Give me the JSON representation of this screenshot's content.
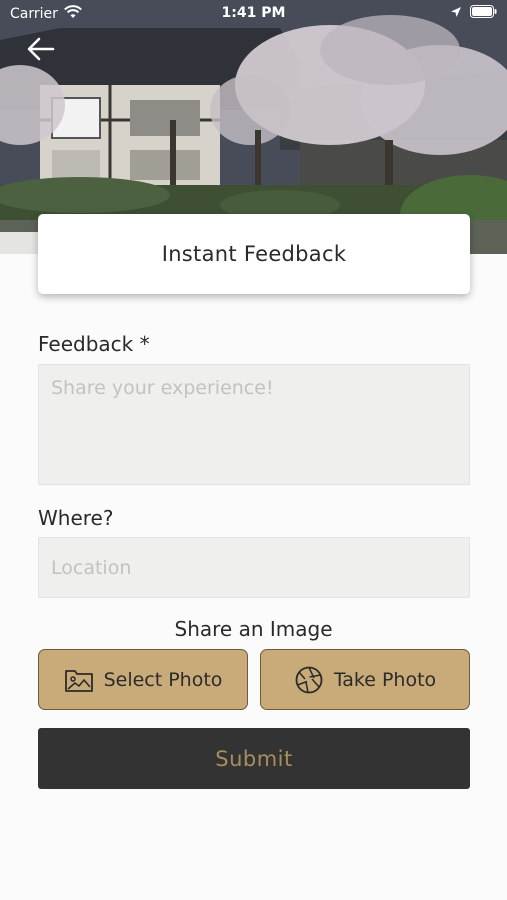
{
  "status_bar": {
    "carrier": "Carrier",
    "time": "1:41 PM"
  },
  "header": {
    "title": "Instant Feedback"
  },
  "form": {
    "feedback_label": "Feedback *",
    "feedback_placeholder": "Share your experience!",
    "feedback_value": "",
    "where_label": "Where?",
    "where_placeholder": "Location",
    "where_value": ""
  },
  "image_share": {
    "title": "Share an Image",
    "select_photo_label": "Select Photo",
    "take_photo_label": "Take Photo"
  },
  "submit": {
    "label": "Submit"
  },
  "colors": {
    "accent_gold": "#c9ab79",
    "submit_bg": "#333333",
    "submit_text": "#a58f5d",
    "field_bg": "#efefee"
  },
  "icons": [
    "back-arrow-icon",
    "wifi-icon",
    "location-arrow-icon",
    "battery-icon",
    "image-folder-icon",
    "camera-aperture-icon"
  ]
}
